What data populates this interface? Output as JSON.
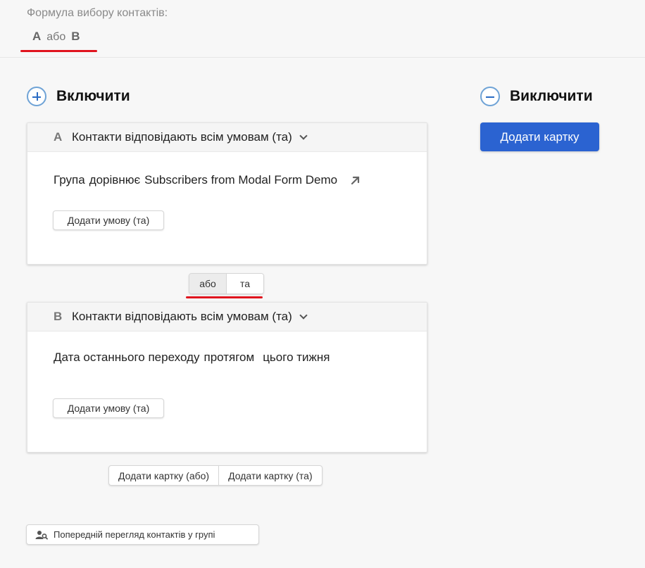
{
  "formula": {
    "label": "Формула вибору контактів:",
    "left": "A",
    "operator": "або",
    "right": "B"
  },
  "include": {
    "title": "Включити",
    "icon": "plus-circle-icon",
    "cards": [
      {
        "letter": "A",
        "header": "Контакти відповідають всім умовам (та)",
        "condition_field": "Група",
        "condition_op": "дорівнює",
        "condition_value": "Subscribers from Modal Form Demo",
        "add_condition": "Додати умову (та)"
      },
      {
        "letter": "B",
        "header": "Контакти відповідають всім умовам (та)",
        "condition_field": "Дата останнього переходу",
        "condition_op": "протягом",
        "condition_value": "цього тижня",
        "add_condition": "Додати умову (та)"
      }
    ],
    "join_toggle": {
      "or_label": "або",
      "and_label": "та",
      "selected": "або"
    },
    "add_card_or": "Додати картку (або)",
    "add_card_and": "Додати картку (та)"
  },
  "exclude": {
    "title": "Виключити",
    "icon": "minus-circle-icon",
    "add_card": "Додати картку"
  },
  "preview": {
    "label": "Попередній перегляд контактів у групі",
    "icon": "user-search-icon"
  },
  "colors": {
    "accent_underline": "#e0141e",
    "primary_button": "#2b63d1",
    "icon_blue": "#2b6cc4"
  }
}
